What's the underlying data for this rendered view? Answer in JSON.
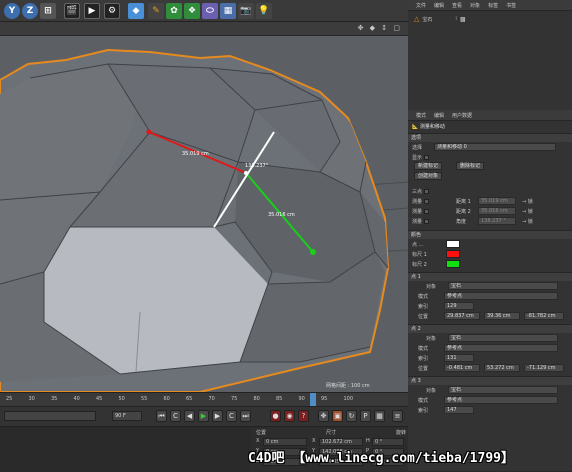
{
  "toolbar": {
    "icons": [
      "undo-icon",
      "redo-icon",
      "live-select-icon",
      "render-view-icon",
      "render-region-icon",
      "render-settings-icon",
      "cube-icon",
      "pen-icon",
      "subdivision-icon",
      "array-icon",
      "deformer-icon",
      "floor-icon",
      "camera-icon",
      "light-icon"
    ],
    "labels": [
      "Y",
      "Z"
    ]
  },
  "object_manager": {
    "menu": [
      "文件",
      "编辑",
      "查看",
      "对象",
      "标签",
      "书签"
    ],
    "object_name": "宝石"
  },
  "viewport": {
    "measure_red": "35.019 cm",
    "measure_green": "35.016 cm",
    "angle": "138.237°",
    "grid_spacing_label": "网格间距 :",
    "grid_spacing_value": "100 cm"
  },
  "attributes": {
    "menu": [
      "模式",
      "编辑",
      "用户数据"
    ],
    "tool_title": "测量和移动",
    "tab_options": "选项",
    "select_label": "选择",
    "select_value": "测量和移动 0",
    "show_label": "显示",
    "new_marker_button": "新建标记",
    "delete_marker_button": "删除标记",
    "create_object_button": "创建对象",
    "three_point_label": "三点",
    "measure_label": "测量",
    "distance1_label": "距离 1",
    "distance1_value": "35.019 cm",
    "distance2_label": "距离 2",
    "distance2_value": "35.016 cm",
    "angle_label": "角度",
    "angle_value": "138.237 °",
    "lock_label": "→ 锁",
    "color_section": "颜色",
    "color_point_label": "点 ...",
    "color_mark1_label": "标尺 1",
    "color_mark2_label": "标尺 2",
    "colors": {
      "point": "#ffffff",
      "mark1": "#ff1010",
      "mark2": "#10e010"
    },
    "point1_section": "点 1",
    "point2_section": "点 2",
    "point3_section": "点 3",
    "object_label": "对象",
    "object_value": "宝石",
    "mode_label": "模式",
    "mode_value": "参考点",
    "index_label": "索引",
    "index_p1": "129",
    "index_p2": "131",
    "index_p3": "147",
    "pos_label": "位置",
    "pos1": [
      "29.837 cm",
      "39.36 cm",
      "-81.782 cm"
    ],
    "pos2": [
      "-0.481 cm",
      "53.272 cm",
      "-71.129 cm"
    ]
  },
  "timeline": {
    "ticks": [
      "25",
      "30",
      "35",
      "40",
      "45",
      "50",
      "55",
      "60",
      "65",
      "70",
      "75",
      "80",
      "85",
      "90",
      "95",
      "100"
    ]
  },
  "transport": {
    "frame_end": "90 F"
  },
  "coords": {
    "headers": [
      "位置",
      "尺寸",
      "旋转"
    ],
    "rows": [
      {
        "axis": "X",
        "pos": "0 cm",
        "size": "102.672 cm",
        "rot_label": "H",
        "rot": "0 °"
      },
      {
        "axis": "Y",
        "pos": "0 cm",
        "size": "142.008 cm",
        "rot_label": "P",
        "rot": "0 °"
      },
      {
        "axis": "Z",
        "pos": "0 cm",
        "size": "164.055 cm",
        "rot_label": "B",
        "rot": "0 °"
      }
    ]
  },
  "watermark": "C4D吧 【www.linecg.com/tieba/1799】"
}
